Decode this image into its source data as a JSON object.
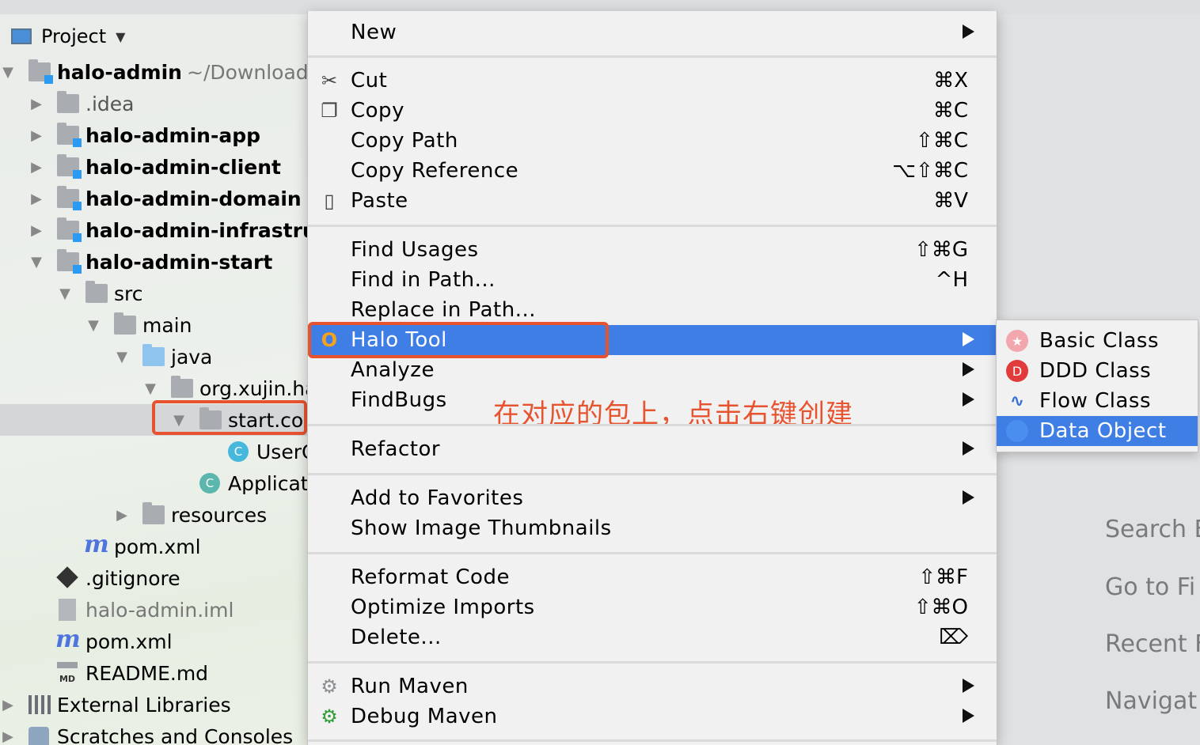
{
  "project_panel": {
    "title": "Project",
    "root_name": "halo-admin",
    "root_path": "~/Downloads",
    "items": [
      {
        "label": ".idea"
      },
      {
        "label": "halo-admin-app"
      },
      {
        "label": "halo-admin-client"
      },
      {
        "label": "halo-admin-domain"
      },
      {
        "label": "halo-admin-infrastruc"
      },
      {
        "label": "halo-admin-start"
      },
      {
        "label": "src"
      },
      {
        "label": "main"
      },
      {
        "label": "java"
      },
      {
        "label": "org.xujin.ha"
      },
      {
        "label": "start.co"
      },
      {
        "label": "UserC"
      },
      {
        "label": "Applicat"
      },
      {
        "label": "resources"
      },
      {
        "label": "pom.xml"
      },
      {
        "label": ".gitignore"
      },
      {
        "label": "halo-admin.iml"
      },
      {
        "label": "pom.xml"
      },
      {
        "label": "README.md"
      },
      {
        "label": "External Libraries"
      },
      {
        "label": "Scratches and Consoles"
      }
    ],
    "md_badge": "MD",
    "class_badge": "C"
  },
  "context_menu": {
    "new": "New",
    "cut": "Cut",
    "cut_shortcut": "⌘X",
    "copy": "Copy",
    "copy_shortcut": "⌘C",
    "copy_path": "Copy Path",
    "copy_path_shortcut": "⇧⌘C",
    "copy_reference": "Copy Reference",
    "copy_reference_shortcut": "⌥⇧⌘C",
    "paste": "Paste",
    "paste_shortcut": "⌘V",
    "find_usages": "Find Usages",
    "find_usages_shortcut": "⇧⌘G",
    "find_in_path": "Find in Path...",
    "find_in_path_shortcut": "^H",
    "replace_in_path": "Replace in Path...",
    "halo_tool": "Halo Tool",
    "analyze": "Analyze",
    "findbugs": "FindBugs",
    "refactor": "Refactor",
    "add_to_favorites": "Add to Favorites",
    "show_image_thumbnails": "Show Image Thumbnails",
    "reformat_code": "Reformat Code",
    "reformat_code_shortcut": "⇧⌘F",
    "optimize_imports": "Optimize Imports",
    "optimize_imports_shortcut": "⇧⌘O",
    "delete": "Delete...",
    "delete_shortcut": "⌦",
    "run_maven": "Run Maven",
    "debug_maven": "Debug Maven",
    "annotation": "在对应的包上，点击右键创建"
  },
  "submenu": {
    "basic_class": "Basic Class",
    "ddd_class": "DDD Class",
    "ddd_badge": "D",
    "flow_class": "Flow Class",
    "data_object": "Data Object"
  },
  "editor_hints": [
    "Search E",
    "Go to Fi",
    "Recent F",
    "Navigat"
  ],
  "colors": {
    "accent": "#3f7ee5",
    "highlight_box": "#e8532f"
  }
}
